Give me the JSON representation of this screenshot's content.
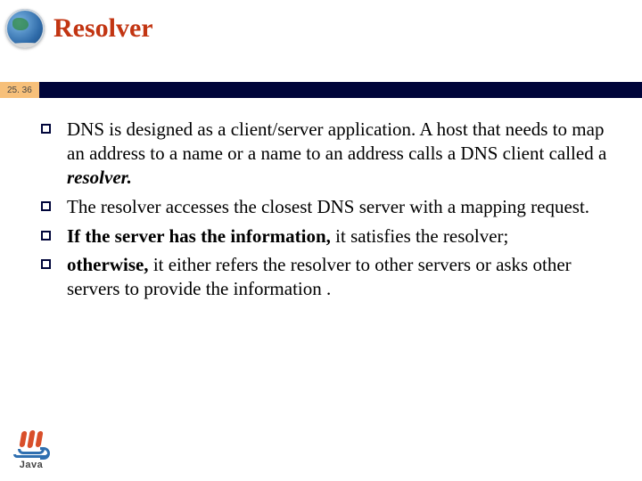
{
  "header": {
    "title": "Resolver",
    "logo_name": "globe-icon"
  },
  "page_badge": "25. 36",
  "colors": {
    "title": "#c23512",
    "band": "#00053a",
    "badge_bg": "#f7c07a"
  },
  "bullets": [
    {
      "segments": [
        {
          "t": "DNS is designed as a client/server application. A host that needs to map an address to a name or a name to an address calls a DNS client called a "
        },
        {
          "t": "resolver.",
          "bi": true
        }
      ]
    },
    {
      "segments": [
        {
          "t": "The resolver accesses  the closest DNS server with a mapping request."
        }
      ]
    },
    {
      "segments": [
        {
          "t": "If the server has the information,",
          "b": true
        },
        {
          "t": " it satisfies the resolver;"
        }
      ]
    },
    {
      "segments": [
        {
          "t": "otherwise,",
          "b": true
        },
        {
          "t": " it either refers the resolver to other servers or asks other servers to provide the information ."
        }
      ]
    }
  ],
  "footer": {
    "java_label": "Java"
  }
}
